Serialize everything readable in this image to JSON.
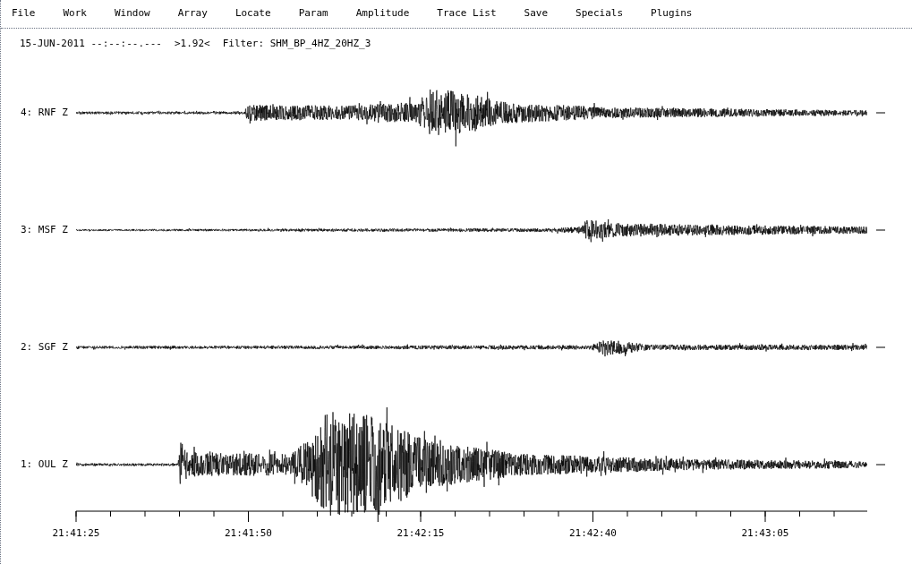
{
  "menu": [
    "File",
    "Work",
    "Window",
    "Array",
    "Locate",
    "Param",
    "Amplitude",
    "Trace List",
    "Save",
    "Specials",
    "Plugins"
  ],
  "header": {
    "time": "15-JUN-2011 --:--:--.---",
    "scale": ">1.92<",
    "filter": "Filter: SHM_BP_4HZ_20HZ_3"
  },
  "traces": [
    {
      "label": "4: RNF Z"
    },
    {
      "label": "3: MSF Z"
    },
    {
      "label": "2: SGF Z"
    },
    {
      "label": "1: OUL Z"
    }
  ],
  "time_axis": {
    "labels": [
      "21:41:25",
      "21:41:50",
      "21:42:15",
      "21:42:40",
      "21:43:05"
    ]
  }
}
